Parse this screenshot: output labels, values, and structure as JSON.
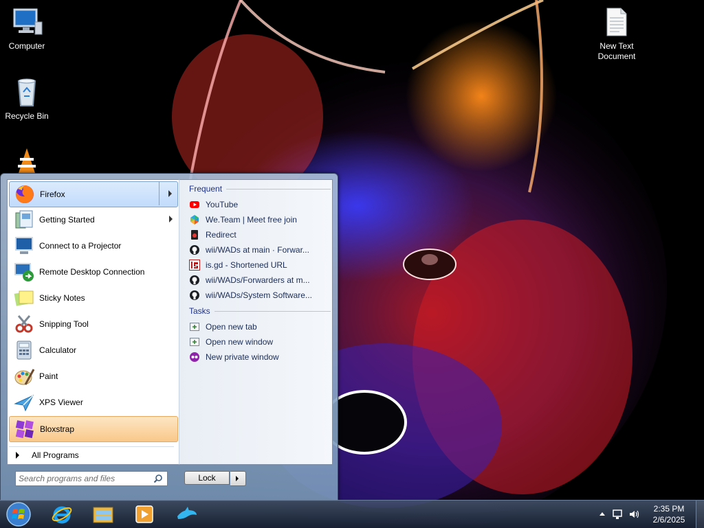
{
  "desktop": {
    "icons": [
      {
        "label": "Computer",
        "icon": "computer-icon"
      },
      {
        "label": "Recycle Bin",
        "icon": "recycle-bin-icon"
      },
      {
        "label": "New Text Document",
        "icon": "text-document-icon"
      }
    ],
    "vlc_icon": "vlc-icon"
  },
  "start_menu": {
    "programs": [
      {
        "label": "Firefox",
        "icon": "firefox-icon",
        "has_submenu": true,
        "highlighted": true
      },
      {
        "label": "Getting Started",
        "icon": "getting-started-icon",
        "has_submenu": true
      },
      {
        "label": "Connect to a Projector",
        "icon": "projector-icon"
      },
      {
        "label": "Remote Desktop Connection",
        "icon": "remote-desktop-icon"
      },
      {
        "label": "Sticky Notes",
        "icon": "sticky-notes-icon"
      },
      {
        "label": "Snipping Tool",
        "icon": "snipping-tool-icon"
      },
      {
        "label": "Calculator",
        "icon": "calculator-icon"
      },
      {
        "label": "Paint",
        "icon": "paint-icon"
      },
      {
        "label": "XPS Viewer",
        "icon": "xps-viewer-icon"
      },
      {
        "label": "Bloxstrap",
        "icon": "bloxstrap-icon",
        "new_install": true
      }
    ],
    "all_programs_label": "All Programs",
    "frequent_title": "Frequent",
    "frequent": [
      {
        "label": "YouTube",
        "icon": "youtube-icon"
      },
      {
        "label": "We.Team | Meet free join",
        "icon": "weteam-icon"
      },
      {
        "label": "Redirect",
        "icon": "redirect-icon"
      },
      {
        "label": "wii/WADs at main · Forwar...",
        "icon": "github-icon"
      },
      {
        "label": "is.gd - Shortened URL",
        "icon": "isgd-icon"
      },
      {
        "label": "wii/WADs/Forwarders at m...",
        "icon": "github-icon"
      },
      {
        "label": "wii/WADs/System Software...",
        "icon": "github-icon"
      }
    ],
    "tasks_title": "Tasks",
    "tasks": [
      {
        "label": "Open new tab",
        "icon": "new-tab-icon"
      },
      {
        "label": "Open new window",
        "icon": "new-window-icon"
      },
      {
        "label": "New private window",
        "icon": "private-window-icon"
      }
    ],
    "search_placeholder": "Search programs and files",
    "lock_label": "Lock"
  },
  "taskbar": {
    "pinned": [
      "start-orb-icon",
      "internet-explorer-icon",
      "file-explorer-icon",
      "media-player-icon",
      "dolphin-icon"
    ],
    "clock_time": "2:35 PM",
    "clock_date": "2/6/2025"
  },
  "colors": {
    "highlight_blue": "#c1dbfc",
    "highlight_orange": "#f9c88a",
    "section_title": "#1e3287"
  }
}
